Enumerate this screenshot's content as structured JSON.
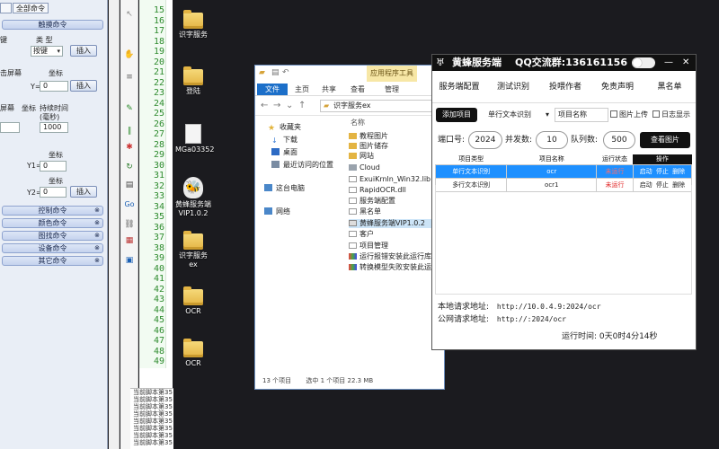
{
  "cmd_panel": {
    "tab_label": "全部命令",
    "sections": {
      "touch": "触摸命令",
      "control": "控制命令",
      "color": "颜色命令",
      "image": "图找命令",
      "device": "设备命令",
      "other": "其它命令"
    },
    "labels": {
      "type_partial": "键",
      "type_head": "类 型",
      "screen_click": "击屏幕",
      "coord1": "坐标",
      "y": "Y=",
      "screen2": "屏幕",
      "coord2": "坐标",
      "duration": "持续时间\n(毫秒)",
      "coord3": "坐标",
      "y1": "Y1=",
      "coord4": "坐标",
      "y2": "Y2="
    },
    "inputs": {
      "y_val": "0",
      "duration_val": "1000",
      "y1_val": "0",
      "y2_val": "0"
    },
    "selects": {
      "key_value": "按键"
    },
    "buttons": {
      "insert": "插入"
    }
  },
  "editor": {
    "line_numbers": [
      "15",
      "16",
      "17",
      "18",
      "19",
      "20",
      "21",
      "22",
      "23",
      "24",
      "25",
      "26",
      "27",
      "28",
      "29",
      "30",
      "31",
      "32",
      "33",
      "34",
      "35",
      "36",
      "37",
      "38",
      "39",
      "40",
      "41",
      "42",
      "43",
      "44",
      "45",
      "46",
      "47",
      "48",
      "49"
    ],
    "output_lines": [
      "当前脚本第35",
      "当前脚本第35",
      "当前脚本第35",
      "当前脚本第35",
      "当前脚本第35",
      "当前脚本第35",
      "当前脚本第35",
      "当前脚本第35"
    ]
  },
  "desktop": {
    "icons": [
      {
        "label": "识字服务"
      },
      {
        "label": "登陆"
      },
      {
        "label": "MGa03352"
      },
      {
        "label": "黄蜂服务端\nVIP1.0.2"
      },
      {
        "label": "识字服务ex"
      },
      {
        "label": "OCR"
      },
      {
        "label": "OCR"
      }
    ]
  },
  "explorer": {
    "app_tools": "应用程序工具",
    "ribbon_tabs": [
      "文件",
      "主页",
      "共享",
      "查看",
      "管理"
    ],
    "address": "识字服务ex",
    "nav": {
      "quick_access": "收藏夹",
      "downloads": "下载",
      "desktop": "桌面",
      "recent": "最近访问的位置",
      "this_pc": "这台电脑",
      "network": "网络"
    },
    "column_name": "名称",
    "files": [
      "教程图片",
      "图片储存",
      "网站",
      "Cloud",
      "ExuiKrnln_Win32.lib",
      "RapidOCR.dll",
      "服务端配置",
      "黑名单",
      "黄蜂服务端VIP1.0.2",
      "客户",
      "项目管理",
      "运行报错安装此运行库",
      "转换模型失败安装此运行库"
    ],
    "status": {
      "count": "13 个项目",
      "selected": "选中 1 个项目  22.3 MB"
    }
  },
  "service": {
    "app_name": "黄蜂服务端",
    "qq_group": "QQ交流群:136161156",
    "min_label": "—",
    "close_label": "✕",
    "tabs": [
      "服务端配置",
      "测试识别",
      "投喂作者",
      "免责声明",
      "黑名单"
    ],
    "add_project": "添加项目",
    "project_type_select": "单行文本识别",
    "project_name_placeholder": "项目名称",
    "image_upload": "图片上传",
    "log_display": "日志显示",
    "port_label": "端口号:",
    "port_value": "2024",
    "concurrency_label": "并发数:",
    "concurrency_value": "10",
    "queue_label": "队列数:",
    "queue_value": "500",
    "view_images": "查看图片",
    "table": {
      "headers": [
        "项目类型",
        "项目名称",
        "运行状态",
        "操作"
      ],
      "rows": [
        {
          "type": "单行文本识别",
          "name": "ocr",
          "status": "未运行",
          "actions": [
            "启动",
            "停止",
            "删除"
          ]
        },
        {
          "type": "多行文本识别",
          "name": "ocr1",
          "status": "未运行",
          "actions": [
            "启动",
            "停止",
            "删除"
          ]
        }
      ]
    },
    "local_addr_label": "本地请求地址:",
    "local_addr": "http://10.0.4.9:2024/ocr",
    "public_addr_label": "公网请求地址:",
    "public_addr": "http://:2024/ocr",
    "runtime": "运行时间: 0天0时4分14秒"
  },
  "colors": {
    "service_titlebar": "#111111",
    "selected_row": "#1e90ff",
    "stopped_status": "#e02020",
    "explorer_file_tab": "#1c6fc9",
    "desktop_background": "#1b1b1f"
  }
}
